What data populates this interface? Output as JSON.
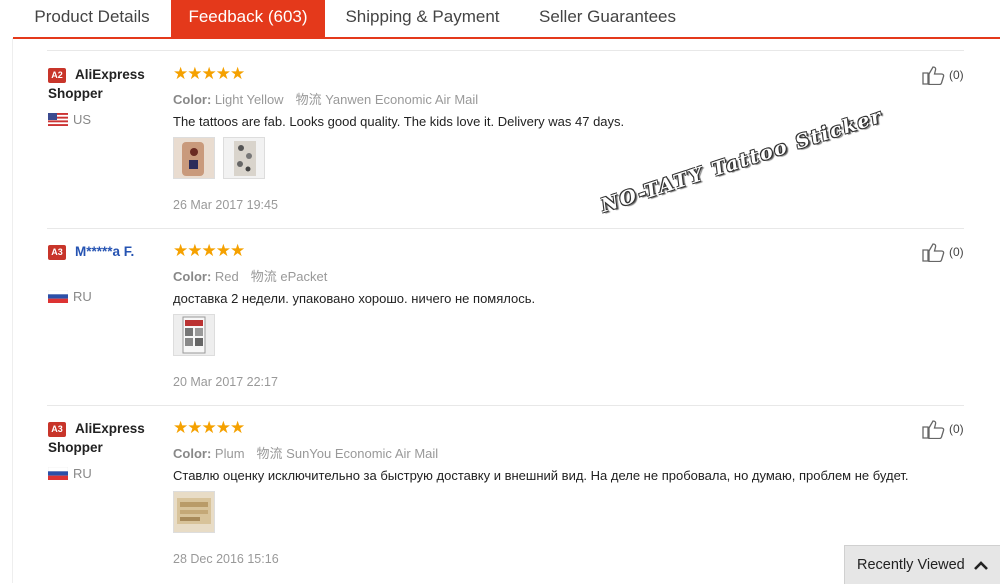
{
  "tabs": [
    {
      "label": "Product Details",
      "active": false
    },
    {
      "label": "Feedback (603)",
      "active": true
    },
    {
      "label": "Shipping & Payment",
      "active": false
    },
    {
      "label": "Seller Guarantees",
      "active": false
    }
  ],
  "watermark": "NO-TATY Tattoo Sticker",
  "recently_viewed": {
    "label": "Recently Viewed",
    "icon": "chevron-up-icon"
  },
  "colors": {
    "accent": "#e4391b",
    "stars": "#f5a100",
    "badge": "#c8352a"
  },
  "labels": {
    "color": "Color:",
    "ship_prefix": "物流"
  },
  "reviews": [
    {
      "level": "A2",
      "name_line1": "AliExpress",
      "name_line2": "Shopper",
      "country": "US",
      "flag": "us-flag-icon",
      "stars": 5,
      "star_text": "★★★★★",
      "color": "Light Yellow",
      "shipping": "Yanwen Economic Air Mail",
      "text": "The tattoos are fab. Looks good quality. The kids love it. Delivery was 47 days.",
      "photos": 2,
      "date": "26 Mar 2017 19:45",
      "likes": "(0)"
    },
    {
      "level": "A3",
      "name_line1": "M*****a F.",
      "name_line2": "",
      "country": "RU",
      "flag": "ru-flag-icon",
      "stars": 5,
      "star_text": "★★★★★",
      "color": "Red",
      "shipping": "ePacket",
      "text": "доставка 2 недели. упаковано хорошо. ничего не помялось.",
      "photos": 1,
      "date": "20 Mar 2017 22:17",
      "likes": "(0)"
    },
    {
      "level": "A3",
      "name_line1": "AliExpress",
      "name_line2": "Shopper",
      "country": "RU",
      "flag": "ru-flag-icon",
      "stars": 5,
      "star_text": "★★★★★",
      "color": "Plum",
      "shipping": "SunYou Economic Air Mail",
      "text": "Ставлю оценку исключительно за быструю доставку и внешний вид. На деле не пробовала, но думаю, проблем не будет.",
      "photos": 1,
      "date": "28 Dec 2016 15:16",
      "likes": "(0)"
    }
  ]
}
